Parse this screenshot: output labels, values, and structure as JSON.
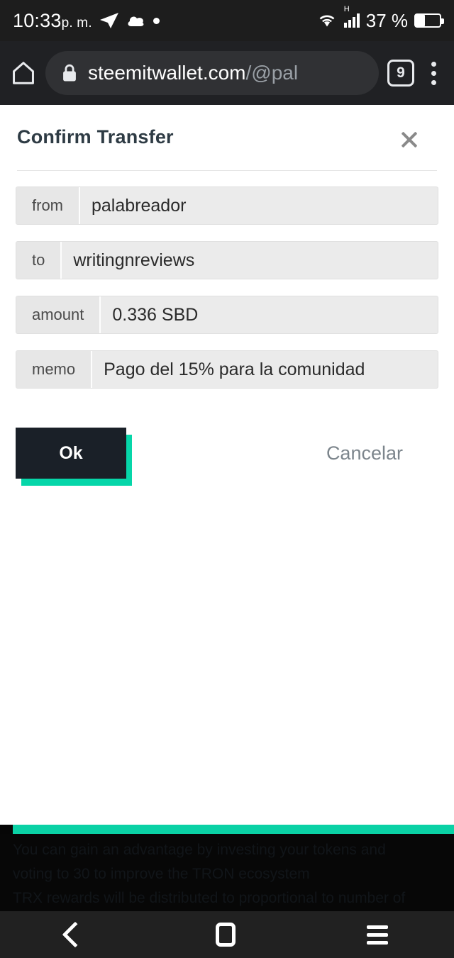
{
  "status_bar": {
    "time": "10:33",
    "ampm": "p. m.",
    "icons": [
      "telegram-icon",
      "cloud-icon",
      "dot-icon"
    ],
    "network_type": "H",
    "battery_percent": "37 %",
    "battery_level": 37,
    "background": "#1d1d1d"
  },
  "browser": {
    "home_icon": "home-icon",
    "lock_icon": "lock-icon",
    "url_host": "steemitwallet.com",
    "url_path": "/@pal",
    "tab_count": "9",
    "menu_icon": "kebab-menu-icon",
    "background": "#202124"
  },
  "dialog": {
    "title": "Confirm Transfer",
    "close_icon": "close-icon",
    "rows": [
      {
        "label": "from",
        "value": "palabreador"
      },
      {
        "label": "to",
        "value": "writingnreviews"
      },
      {
        "label": "amount",
        "value": "0.336 SBD"
      },
      {
        "label": "memo",
        "value": "Pago del 15% para la comunidad"
      }
    ],
    "ok_label": "Ok",
    "cancel_label": "Cancelar",
    "accent_color": "#06d6a9",
    "ok_color": "#1a2028"
  },
  "footer": {
    "bar_color": "#0ad1a5",
    "ghost_lines": [
      "You can gain an advantage by investing your tokens and",
      "voting to 30 to improve the TRON ecosystem",
      "TRX rewards will be distributed to proportional to number of"
    ]
  },
  "nav_bar": {
    "back_icon": "back-chevron-icon",
    "home_icon": "home-square-icon",
    "recents_icon": "recents-menu-icon"
  }
}
